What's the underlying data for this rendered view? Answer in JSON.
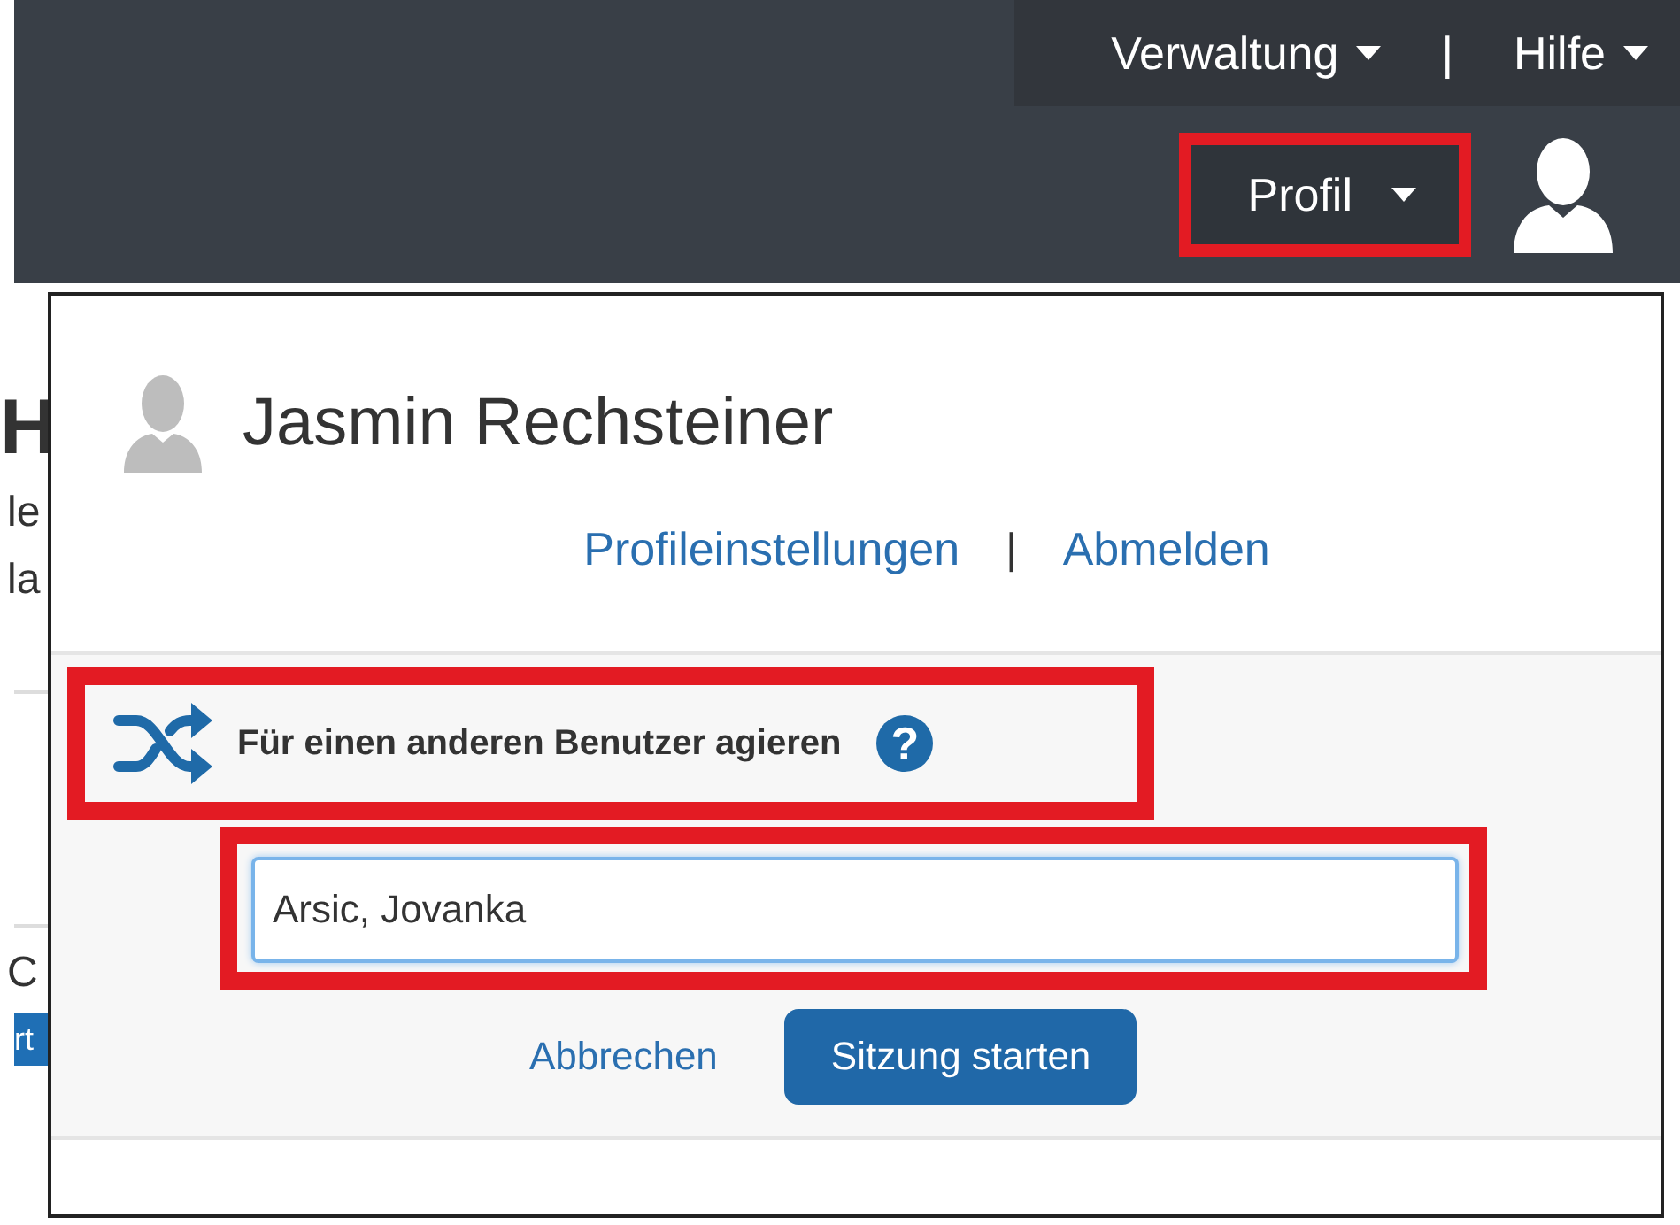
{
  "top_nav": {
    "items": [
      {
        "label": "Verwaltung"
      },
      {
        "label": "Hilfe"
      }
    ],
    "separator": "|"
  },
  "header": {
    "profile_menu": {
      "label": "Profil",
      "highlighted": true,
      "expanded": true
    }
  },
  "background_page": {
    "fragments": [
      {
        "kind": "heading",
        "text": "H"
      },
      {
        "kind": "text",
        "text": "le"
      },
      {
        "kind": "text",
        "text": "la"
      },
      {
        "kind": "rule"
      },
      {
        "kind": "rule"
      },
      {
        "kind": "text",
        "text": "C"
      },
      {
        "kind": "button",
        "text": "rt"
      }
    ]
  },
  "profile_dropdown": {
    "user_name": "Jasmin Rechsteiner",
    "links": [
      "Profileinstellungen",
      "Abmelden"
    ],
    "separator": "|",
    "act_as": {
      "title": "Für einen anderen Benutzer agieren",
      "highlighted": true,
      "help": "?",
      "field": {
        "value": "Arsic, Jovanka",
        "highlighted": true,
        "focused": true
      },
      "cancel": "Abbrechen",
      "start": "Sitzung starten"
    }
  }
}
